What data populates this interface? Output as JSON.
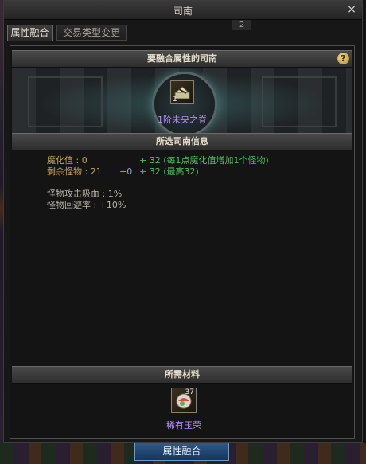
{
  "window": {
    "title": "司南",
    "close_glyph": "×"
  },
  "tabs": [
    {
      "label": "属性融合"
    },
    {
      "label": "交易类型变更"
    }
  ],
  "mini_counter": "2",
  "section_fuse": {
    "title": "要融合属性的司南",
    "help": "?"
  },
  "compass_item": {
    "name": "1阶未央之脊",
    "level": "1",
    "icon": "compass-icon"
  },
  "section_info": {
    "title": "所选司南信息"
  },
  "info": {
    "demonize_label": "魔化值 : 0",
    "demonize_bonus": "+ 32 (每1点魔化值增加1个怪物)",
    "monster_label": "剩余怪物 : 21",
    "monster_plus": "+0",
    "monster_bonus": "+ 32 (最高32)",
    "lifesteal": "怪物攻击吸血 : 1%",
    "evasion": "怪物回避率 : +10%"
  },
  "section_materials": {
    "title": "所需材料"
  },
  "material_item": {
    "name": "稀有玉荣",
    "count": "37",
    "icon": "jade-orb-icon"
  },
  "fuse_button": {
    "label": "属性融合"
  },
  "colors": {
    "accent_purple": "#b58cff",
    "bonus_green": "#4ec25a",
    "label_gold": "#c8a25a",
    "button_blue": "#2d5a8a"
  }
}
